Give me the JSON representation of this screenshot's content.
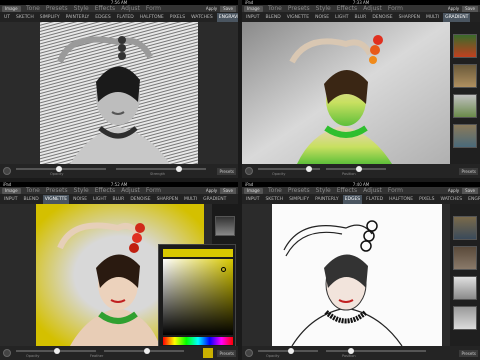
{
  "panels": [
    {
      "status": {
        "carrier": "",
        "time": "7:56 AM",
        "battery": ""
      },
      "menu": {
        "image_btn": "Image",
        "tabs": [
          "Tone",
          "Presets",
          "Style",
          "Effects",
          "Adjust",
          "Form"
        ],
        "apply": "Apply",
        "save": "Save"
      },
      "filters": [
        "UT",
        "SKETCH",
        "SIMPLIFY",
        "PAINTERLY",
        "EDGES",
        "FLATED",
        "HALFTONE",
        "PIXELS",
        "WATCHES",
        "ENGRAVE"
      ],
      "active_filter": "ENGRAVE",
      "bottom": {
        "label1": "Opacity",
        "label2": "Strength",
        "presets": "Presets"
      }
    },
    {
      "status": {
        "carrier": "iPad",
        "time": "7:33 AM",
        "battery": ""
      },
      "menu": {
        "image_btn": "Image",
        "tabs": [
          "Tone",
          "Presets",
          "Style",
          "Effects",
          "Adjust",
          "Form"
        ],
        "apply": "Apply",
        "save": "Save"
      },
      "filters": [
        "INPUT",
        "BLEND",
        "VIGNETTE",
        "NOISE",
        "LIGHT",
        "BLUR",
        "DENOISE",
        "SHARPEN",
        "MULTI",
        "GRADIENT"
      ],
      "active_filter": "GRADIENT",
      "bottom": {
        "label1": "Opacity",
        "label2": "Position",
        "presets": "Presets"
      }
    },
    {
      "status": {
        "carrier": "iPad",
        "time": "7:52 AM",
        "battery": ""
      },
      "menu": {
        "image_btn": "Image",
        "tabs": [
          "Tone",
          "Presets",
          "Style",
          "Effects",
          "Adjust",
          "Form"
        ],
        "apply": "Apply",
        "save": "Save"
      },
      "filters": [
        "INPUT",
        "BLEND",
        "VIGNETTE",
        "NOISE",
        "LIGHT",
        "BLUR",
        "DENOISE",
        "SHARPEN",
        "MULTI",
        "GRADIENT"
      ],
      "active_filter": "VIGNETTE",
      "bottom": {
        "label1": "Opacity",
        "label2": "Feather",
        "presets": "Presets"
      }
    },
    {
      "status": {
        "carrier": "iPad",
        "time": "7:40 AM",
        "battery": ""
      },
      "menu": {
        "image_btn": "Image",
        "tabs": [
          "Tone",
          "Presets",
          "Style",
          "Effects",
          "Adjust",
          "Form"
        ],
        "apply": "Apply",
        "save": "Save"
      },
      "filters": [
        "INPUT",
        "SKETCH",
        "SIMPLIFY",
        "PAINTERLY",
        "EDGES",
        "FLATED",
        "HALFTONE",
        "PIXELS",
        "WATCHES",
        "ENGR"
      ],
      "active_filter": "EDGES",
      "bottom": {
        "label1": "Opacity",
        "label2": "Position",
        "presets": "Presets"
      }
    }
  ]
}
